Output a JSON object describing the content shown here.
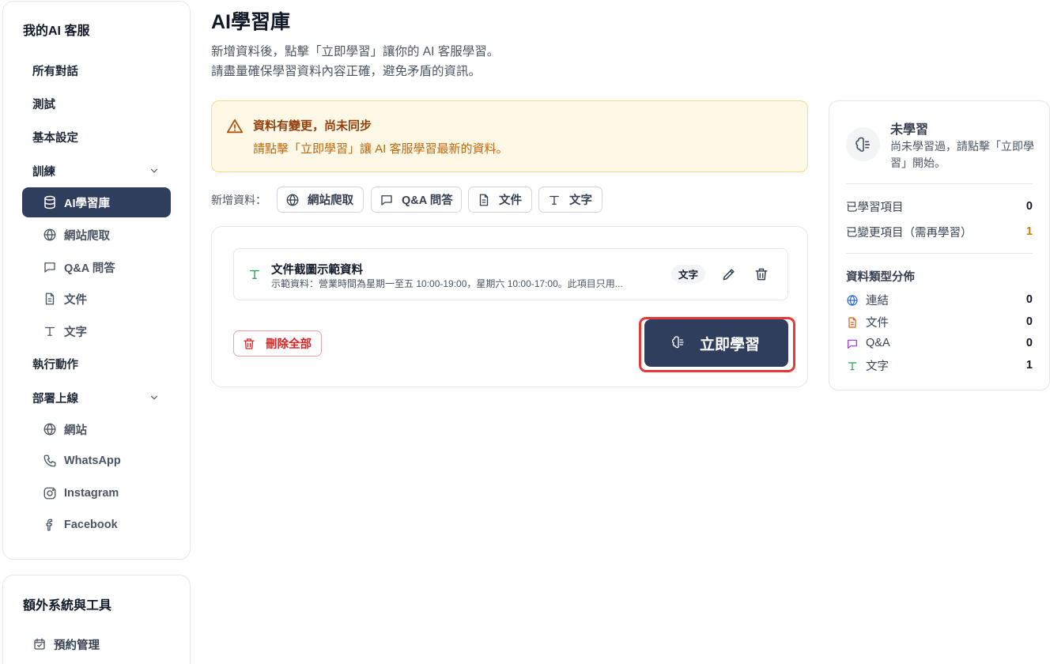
{
  "sidebar": {
    "title": "我的AI 客服",
    "items": {
      "conversations": "所有對話",
      "test": "測試",
      "basic_settings": "基本設定",
      "training": "訓練",
      "training_sub": [
        "AI學習庫",
        "網站爬取",
        "Q&A 問答",
        "文件",
        "文字"
      ],
      "actions": "執行動作",
      "deploy": "部署上線",
      "deploy_sub": [
        "網站",
        "WhatsApp",
        "Instagram",
        "Facebook"
      ]
    },
    "extra_title": "額外系統與工具",
    "extra_items": [
      "預約管理"
    ]
  },
  "main": {
    "title": "AI學習庫",
    "desc_lines": [
      "新增資料後，點擊「立即學習」讓你的 AI 客服學習。",
      "請盡量確保學習資料內容正確，避免矛盾的資訊。"
    ],
    "alert": {
      "title": "資料有變更，尚未同步",
      "body": "請點擊「立即學習」讓 AI 客服學習最新的資料。"
    },
    "add_label": "新增資料：",
    "add_buttons": [
      "網站爬取",
      "Q&A 問答",
      "文件",
      "文字"
    ],
    "item": {
      "title": "文件截圖示範資料",
      "desc": "示範資料：營業時間為星期一至五 10:00-19:00，星期六 10:00-17:00。此項目只用...",
      "tag": "文字"
    },
    "delete_all": "刪除全部",
    "learn_now": "立即學習"
  },
  "status": {
    "title": "未學習",
    "desc": "尚未學習過，請點擊「立即學習」開始。",
    "learned_label": "已學習項目",
    "learned_value": "0",
    "changed_label": "已變更項目（需再學習）",
    "changed_value": "1",
    "dist_title": "資料類型分佈",
    "dist": [
      {
        "label": "連結",
        "value": "0",
        "icon": "globe-icon",
        "color": "#2563eb"
      },
      {
        "label": "文件",
        "value": "0",
        "icon": "file-icon",
        "color": "#ea580c"
      },
      {
        "label": "Q&A",
        "value": "0",
        "icon": "chat-icon",
        "color": "#9333ea"
      },
      {
        "label": "文字",
        "value": "1",
        "icon": "text-icon",
        "color": "#16a34a"
      }
    ]
  },
  "colors": {
    "accent": "#2f3e5c",
    "alert_bg": "#fef9e7",
    "alert_text": "#c2650c",
    "danger": "#dc2626",
    "highlight": "#e53935"
  }
}
